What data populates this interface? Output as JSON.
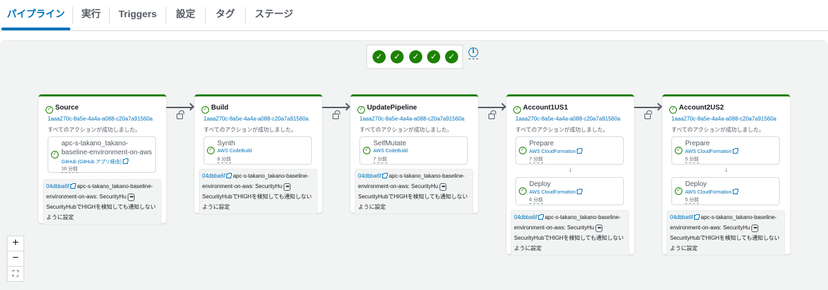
{
  "tabs": [
    {
      "label": "パイプライン",
      "active": true
    },
    {
      "label": "実行",
      "active": false
    },
    {
      "label": "Triggers",
      "active": false
    },
    {
      "label": "設定",
      "active": false
    },
    {
      "label": "タグ",
      "active": false
    },
    {
      "label": "ステージ",
      "active": false
    }
  ],
  "summary": {
    "check_glyph": "✓",
    "stage_count": 5,
    "info_glyph": "i"
  },
  "zoom": {
    "in": "+",
    "out": "−",
    "fit": "⛶"
  },
  "colors": {
    "accent": "#0073bb",
    "success": "#1d8102",
    "canvas": "#f2f3f3"
  },
  "stages": [
    {
      "name": "Source",
      "execution_id": "1aaa270c-8a5e-4a4a-a088-c20a7a91560a",
      "status": "すべてのアクションが成功しました。",
      "actions": [
        {
          "name": "apc-s-takano_takano-baseline-environment-on-aws",
          "provider": "GitHub (GitHub アプリ経由)",
          "time": "10 分前"
        }
      ],
      "commit": {
        "hash": "04dbba6f",
        "text": "apc-s-takano_takano-baseline-environment-on-aws: SecurityHu",
        "dots": "•••",
        "rest": "SecurityHubでHIGHを検知しても通知しないように設定"
      }
    },
    {
      "name": "Build",
      "execution_id": "1aaa270c-8a5e-4a4a-a088-c20a7a91560a",
      "status": "すべてのアクションが成功しました。",
      "actions": [
        {
          "name": "Synth",
          "provider": "AWS CodeBuild",
          "time": "8 分前"
        }
      ],
      "commit": {
        "hash": "04dbba6f",
        "text": "apc-s-takano_takano-baseline-environment-on-aws: SecurityHu",
        "dots": "•••",
        "rest": "SecurityHubでHIGHを検知しても通知しないように設定"
      }
    },
    {
      "name": "UpdatePipeline",
      "execution_id": "1aaa270c-8a5e-4a4a-a088-c20a7a91560a",
      "status": "すべてのアクションが成功しました。",
      "actions": [
        {
          "name": "SelfMutate",
          "provider": "AWS CodeBuild",
          "time": "7 分前"
        }
      ],
      "commit": {
        "hash": "04dbba6f",
        "text": "apc-s-takano_takano-baseline-environment-on-aws: SecurityHu",
        "dots": "•••",
        "rest": "SecurityHubでHIGHを検知しても通知しないように設定"
      }
    },
    {
      "name": "Account1US1",
      "execution_id": "1aaa270c-8a5e-4a4a-a088-c20a7a91560a",
      "status": "すべてのアクションが成功しました。",
      "actions": [
        {
          "name": "Prepare",
          "provider": "AWS CloudFormation",
          "time": "7 分前"
        },
        {
          "name": "Deploy",
          "provider": "AWS CloudFormation",
          "time": "6 分前"
        }
      ],
      "commit": {
        "hash": "04dbba6f",
        "text": "apc-s-takano_takano-baseline-environment-on-aws: SecurityHu",
        "dots": "•••",
        "rest": "SecurityHubでHIGHを検知しても通知しないように設定"
      }
    },
    {
      "name": "Account2US2",
      "execution_id": "1aaa270c-8a5e-4a4a-a088-c20a7a91560a",
      "status": "すべてのアクションが成功しました。",
      "actions": [
        {
          "name": "Prepare",
          "provider": "AWS CloudFormation",
          "time": "5 分前"
        },
        {
          "name": "Deploy",
          "provider": "AWS CloudFormation",
          "time": "5 分前"
        }
      ],
      "commit": {
        "hash": "04dbba6f",
        "text": "apc-s-takano_takano-baseline-environment-on-aws: SecurityHu",
        "dots": "•••",
        "rest": "SecurityHubでHIGHを検知しても通知しないように設定"
      }
    }
  ],
  "icons": {
    "check": "check-circle-icon",
    "external": "external-link-icon",
    "lock": "unlock-icon",
    "arrow": "arrow-right-icon",
    "down": "arrow-down-icon"
  }
}
